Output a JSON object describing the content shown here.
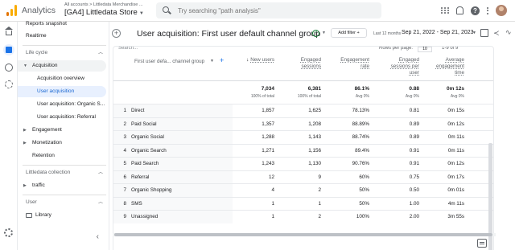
{
  "app": {
    "name": "Analytics",
    "breadcrumb": "All accounts > Littledata Merchandise ...",
    "property": "[GA4] Littledata Store",
    "search_placeholder": "Try searching \"path analysis\"",
    "icons": [
      "apps-grid-icon",
      "bell-icon",
      "help-icon",
      "more-vert-icon",
      "avatar"
    ],
    "brand_colors": {
      "logo_orange": "#f9ab00",
      "logo_dark_orange": "#e37400",
      "active_blue": "#1967d2",
      "active_bg": "#e8f0fe"
    }
  },
  "sidebar": {
    "reports_snapshot": "Reports snapshot",
    "realtime": "Realtime",
    "lifecycle_label": "Life cycle",
    "acquisition": "Acquisition",
    "acquisition_overview": "Acquisition overview",
    "user_acquisition": "User acquisition",
    "user_acq_organic": "User acquisition: Organic S...",
    "user_acq_referral": "User acquisition: Referral",
    "engagement": "Engagement",
    "monetization": "Monetization",
    "retention": "Retention",
    "collection_label": "Littledata collection",
    "traffic": "traffic",
    "user_label": "User",
    "library": "Library",
    "collapse_symbol": "‹"
  },
  "report": {
    "title": "User acquisition: First user default channel group",
    "add_filter": "Add filter",
    "date_label": "Last 12 months",
    "date_range": "Sep 21, 2022 - Sep 21, 2023",
    "search_placeholder": "Search...",
    "rows_per_page_label": "Rows per page:",
    "rows_per_page_value": "10",
    "pager_text": "1-9 of 9"
  },
  "table": {
    "dimension_header": "First user defa... channel group",
    "columns": [
      {
        "label": "New users",
        "sorted": true,
        "total": "7,034",
        "sub": "100% of total"
      },
      {
        "label": "Engaged sessions",
        "total": "6,381",
        "sub": "100% of total"
      },
      {
        "label": "Engagement rate",
        "total": "86.1%",
        "sub": "Avg 0%"
      },
      {
        "label": "Engaged sessions per user",
        "total": "0.88",
        "sub": "Avg 0%"
      },
      {
        "label": "Average engagement time",
        "total": "0m 12s",
        "sub": "Avg 0%"
      }
    ],
    "rows": [
      {
        "idx": "1",
        "channel": "Direct",
        "new_users": "1,857",
        "engaged": "1,625",
        "rate": "78.13%",
        "per_user": "0.81",
        "avg_time": "0m 15s"
      },
      {
        "idx": "2",
        "channel": "Paid Social",
        "new_users": "1,357",
        "engaged": "1,208",
        "rate": "88.89%",
        "per_user": "0.89",
        "avg_time": "0m 12s"
      },
      {
        "idx": "3",
        "channel": "Organic Social",
        "new_users": "1,288",
        "engaged": "1,143",
        "rate": "88.74%",
        "per_user": "0.89",
        "avg_time": "0m 11s"
      },
      {
        "idx": "4",
        "channel": "Organic Search",
        "new_users": "1,271",
        "engaged": "1,156",
        "rate": "89.4%",
        "per_user": "0.91",
        "avg_time": "0m 11s"
      },
      {
        "idx": "5",
        "channel": "Paid Search",
        "new_users": "1,243",
        "engaged": "1,130",
        "rate": "90.76%",
        "per_user": "0.91",
        "avg_time": "0m 12s"
      },
      {
        "idx": "6",
        "channel": "Referral",
        "new_users": "12",
        "engaged": "9",
        "rate": "60%",
        "per_user": "0.75",
        "avg_time": "0m 17s"
      },
      {
        "idx": "7",
        "channel": "Organic Shopping",
        "new_users": "4",
        "engaged": "2",
        "rate": "50%",
        "per_user": "0.50",
        "avg_time": "0m 01s"
      },
      {
        "idx": "8",
        "channel": "SMS",
        "new_users": "1",
        "engaged": "1",
        "rate": "50%",
        "per_user": "1.00",
        "avg_time": "4m 11s"
      },
      {
        "idx": "9",
        "channel": "Unassigned",
        "new_users": "1",
        "engaged": "2",
        "rate": "100%",
        "per_user": "2.00",
        "avg_time": "3m 55s"
      }
    ]
  }
}
